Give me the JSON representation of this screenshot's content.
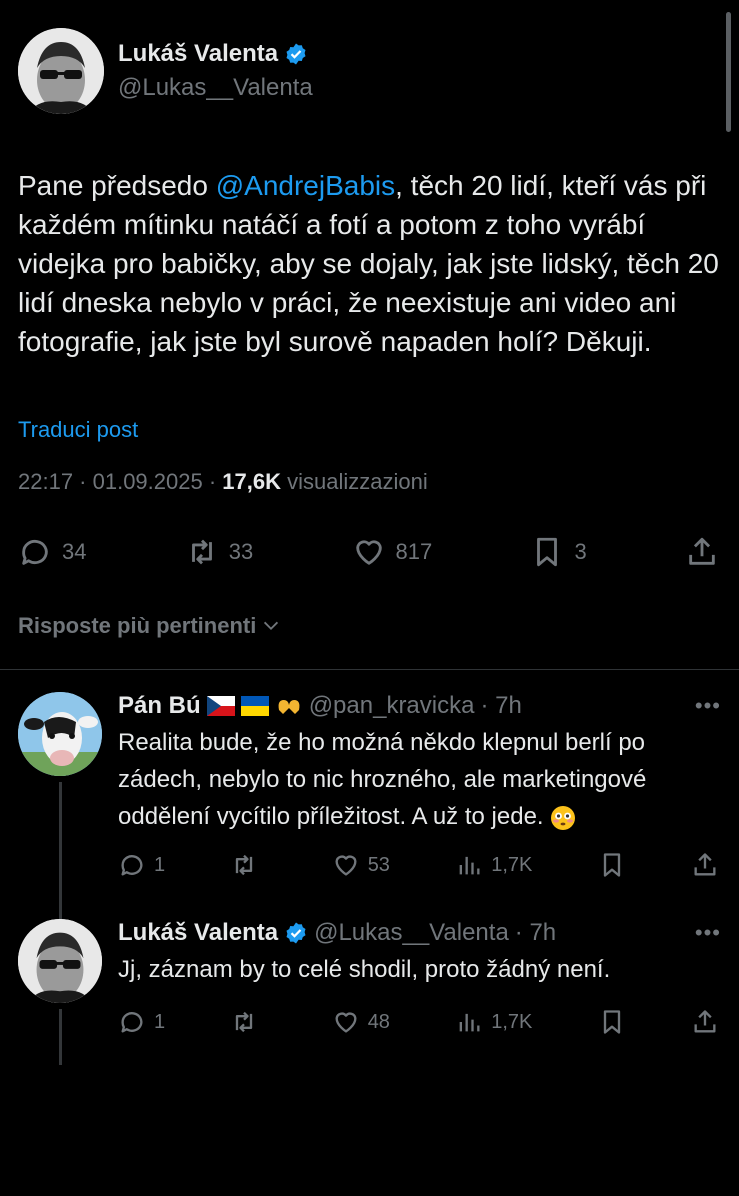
{
  "main": {
    "author_name": "Lukáš Valenta",
    "author_handle": "@Lukas__Valenta",
    "text_before": "Pane předsedo ",
    "mention": "@AndrejBabis",
    "text_after": ", těch 20 lidí, kteří vás při každém mítinku natáčí a fotí a potom z toho vyrábí videjka pro babičky, aby se dojaly, jak jste lidský, těch 20 lidí dneska nebylo v práci, že neexistuje ani video ani fotografie, jak jste byl surově napaden holí? Děkuji.",
    "translate": "Traduci post",
    "time": "22:17 · 01.09.2025 · ",
    "views": "17,6K",
    "views_label": " visualizzazioni",
    "replies": "34",
    "reposts": "33",
    "likes": "817",
    "bookmarks": "3"
  },
  "sort": {
    "label": "Risposte più pertinenti"
  },
  "replies": [
    {
      "name": "Pán Bú",
      "handle": "@pan_kravicka",
      "time": "· 7h",
      "more": "•••",
      "text": "Realita bude, že ho možná někdo klepnul berlí po zádech, nebylo to nic hrozného, ale marketingové oddělení vycítilo příležitost. A už to jede. ",
      "replies": "1",
      "reposts": "",
      "likes": "53",
      "views": "1,7K"
    },
    {
      "name": "Lukáš Valenta",
      "handle": "@Lukas__Valenta",
      "time": "· 7h",
      "more": "•••",
      "text": "Jj, záznam by to celé shodil, proto žádný není.",
      "replies": "1",
      "reposts": "",
      "likes": "48",
      "views": "1,7K"
    }
  ],
  "colors": {
    "accent": "#1d9bf0",
    "muted": "#71767b",
    "text": "#e7e9ea",
    "background": "#000000"
  }
}
